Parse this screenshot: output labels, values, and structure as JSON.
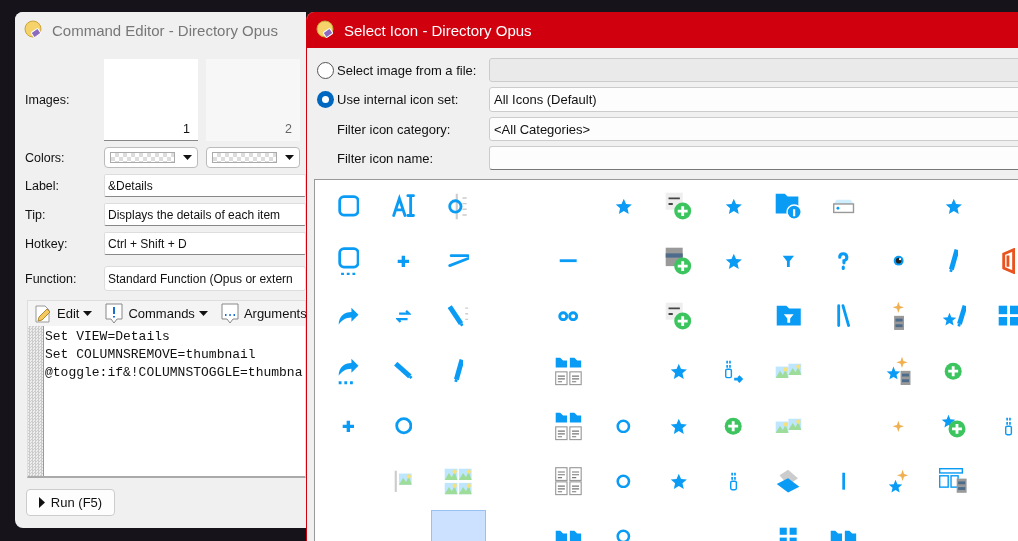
{
  "command_editor": {
    "title": "Command Editor - Directory Opus",
    "images_label": "Images:",
    "images": [
      {
        "number": "1",
        "selected": true
      },
      {
        "number": "2",
        "selected": false
      }
    ],
    "colors_label": "Colors:",
    "fields": [
      {
        "label": "Label:",
        "value": "&Details",
        "kind": "text"
      },
      {
        "label": "Tip:",
        "value": "Displays the details of each item",
        "kind": "text"
      },
      {
        "label": "Hotkey:",
        "value": "Ctrl + Shift + D",
        "kind": "text"
      },
      {
        "label": "Function:",
        "value": "Standard Function (Opus or extern",
        "kind": "dropdown"
      }
    ],
    "toolbar": [
      {
        "label": "Edit",
        "dropdown": true
      },
      {
        "label": "Commands",
        "dropdown": true
      },
      {
        "label": "Arguments",
        "dropdown": false
      }
    ],
    "code_lines": [
      "Set VIEW=Details",
      "Set COLUMNSREMOVE=thumbnail",
      "@toggle:if&!COLUMNSTOGGLE=thumbna"
    ],
    "run_button": "Run (F5)"
  },
  "select_icon": {
    "title": "Select Icon - Directory Opus",
    "sources": [
      {
        "label": "Select image from a file:",
        "selected": false
      },
      {
        "label": "Use internal icon set:",
        "selected": true,
        "value": "All Icons (Default)"
      }
    ],
    "filters": [
      {
        "label": "Filter icon category:",
        "value": "<All Categories>",
        "kind": "dropdown"
      },
      {
        "label": "Filter icon name:",
        "kind": "input"
      }
    ],
    "icon_grid": [
      [
        {
          "kind": "square",
          "selected": false
        },
        {
          "kind": "text-cursor",
          "selected": false
        },
        {
          "kind": "circle-list",
          "selected": false
        },
        {
          "kind": "blank",
          "selected": false
        },
        {
          "kind": "blank",
          "selected": false
        },
        {
          "kind": "star",
          "selected": false
        },
        {
          "kind": "func-plus",
          "selected": false
        },
        {
          "kind": "star",
          "selected": false
        },
        {
          "kind": "folder-info",
          "selected": false
        },
        {
          "kind": "drive",
          "selected": false
        },
        {
          "kind": "blank",
          "selected": false
        },
        {
          "kind": "star",
          "selected": false
        },
        {
          "kind": "blank",
          "selected": false
        }
      ],
      [
        {
          "kind": "square-dots",
          "selected": false
        },
        {
          "kind": "plus",
          "selected": false
        },
        {
          "kind": "slash-line",
          "selected": false
        },
        {
          "kind": "blank",
          "selected": false
        },
        {
          "kind": "minus",
          "selected": false
        },
        {
          "kind": "blank",
          "selected": false
        },
        {
          "kind": "list-plus",
          "selected": false
        },
        {
          "kind": "star",
          "selected": false
        },
        {
          "kind": "filter",
          "selected": false
        },
        {
          "kind": "question",
          "selected": false
        },
        {
          "kind": "eye",
          "selected": false
        },
        {
          "kind": "pencil",
          "selected": false
        },
        {
          "kind": "office",
          "selected": false
        }
      ],
      [
        {
          "kind": "share",
          "selected": false
        },
        {
          "kind": "swap",
          "selected": false
        },
        {
          "kind": "pencil-list",
          "selected": false
        },
        {
          "kind": "blank",
          "selected": false
        },
        {
          "kind": "two-rings",
          "selected": false
        },
        {
          "kind": "blank",
          "selected": false
        },
        {
          "kind": "func-plus",
          "selected": false
        },
        {
          "kind": "blank",
          "selected": false
        },
        {
          "kind": "folder-filter",
          "selected": false
        },
        {
          "kind": "lines",
          "selected": false
        },
        {
          "kind": "sparkle-cabinet",
          "selected": false
        },
        {
          "kind": "star-pencil",
          "selected": false
        },
        {
          "kind": "tiles",
          "selected": false
        }
      ],
      [
        {
          "kind": "share-dots",
          "selected": false
        },
        {
          "kind": "pencil-tilt",
          "selected": false
        },
        {
          "kind": "pencil",
          "selected": false
        },
        {
          "kind": "blank",
          "selected": false
        },
        {
          "kind": "folders-docs",
          "selected": false
        },
        {
          "kind": "blank",
          "selected": false
        },
        {
          "kind": "star",
          "selected": false
        },
        {
          "kind": "usb-arrow",
          "selected": false
        },
        {
          "kind": "landscapes",
          "selected": false
        },
        {
          "kind": "blank",
          "selected": false
        },
        {
          "kind": "star-cabinet",
          "selected": false
        },
        {
          "kind": "plus-circle",
          "selected": false
        },
        {
          "kind": "blank",
          "selected": false
        }
      ],
      [
        {
          "kind": "plus",
          "selected": false
        },
        {
          "kind": "circle",
          "selected": false
        },
        {
          "kind": "blank",
          "selected": false
        },
        {
          "kind": "blank",
          "selected": false
        },
        {
          "kind": "folders-docs",
          "selected": false
        },
        {
          "kind": "ring",
          "selected": false
        },
        {
          "kind": "star",
          "selected": false
        },
        {
          "kind": "plus-circle",
          "selected": false
        },
        {
          "kind": "landscapes",
          "selected": false
        },
        {
          "kind": "blank",
          "selected": false
        },
        {
          "kind": "sparkle",
          "selected": false
        },
        {
          "kind": "star-plus",
          "selected": false
        },
        {
          "kind": "usb",
          "selected": false
        }
      ],
      [
        {
          "kind": "blank",
          "selected": false
        },
        {
          "kind": "image-bar",
          "selected": false
        },
        {
          "kind": "image-grid",
          "selected": false
        },
        {
          "kind": "blank",
          "selected": false
        },
        {
          "kind": "docs-grid",
          "selected": false
        },
        {
          "kind": "ring",
          "selected": false
        },
        {
          "kind": "star",
          "selected": false
        },
        {
          "kind": "usb",
          "selected": false
        },
        {
          "kind": "scanner",
          "selected": false
        },
        {
          "kind": "bar",
          "selected": false
        },
        {
          "kind": "star-sparkle",
          "selected": false
        },
        {
          "kind": "layout",
          "selected": false
        },
        {
          "kind": "blank",
          "selected": false
        }
      ],
      [
        {
          "kind": "blank",
          "selected": false
        },
        {
          "kind": "blank",
          "selected": false
        },
        {
          "kind": "blank",
          "selected": true
        },
        {
          "kind": "blank",
          "selected": false
        },
        {
          "kind": "folders",
          "selected": false
        },
        {
          "kind": "ring",
          "selected": false
        },
        {
          "kind": "blank",
          "selected": false
        },
        {
          "kind": "blank",
          "selected": false
        },
        {
          "kind": "windows",
          "selected": false
        },
        {
          "kind": "folders",
          "selected": false
        },
        {
          "kind": "blank",
          "selected": false
        },
        {
          "kind": "blank",
          "selected": false
        },
        {
          "kind": "blank",
          "selected": false
        }
      ]
    ]
  }
}
